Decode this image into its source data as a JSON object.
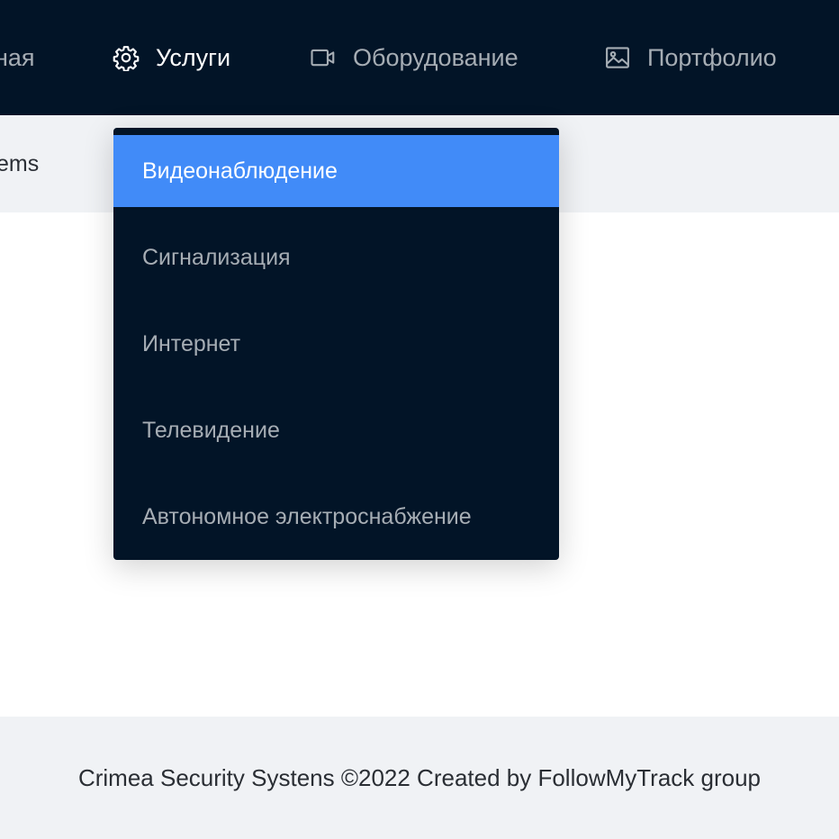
{
  "nav": {
    "items": [
      {
        "label": "ная",
        "icon": ""
      },
      {
        "label": "Услуги",
        "icon": "gear-icon",
        "active": true
      },
      {
        "label": "Оборудование",
        "icon": "video-camera-icon"
      },
      {
        "label": "Портфолио",
        "icon": "image-icon"
      }
    ]
  },
  "subbar": {
    "text": "ems"
  },
  "dropdown": {
    "items": [
      {
        "label": "Видеонаблюдение",
        "selected": true
      },
      {
        "label": "Сигнализация"
      },
      {
        "label": "Интернет"
      },
      {
        "label": "Телевидение"
      },
      {
        "label": "Автономное электроснабжение"
      }
    ]
  },
  "footer": {
    "text": "Crimea Security Systens ©2022 Created by FollowMyTrack group"
  },
  "colors": {
    "nav_bg": "#021427",
    "active_text": "#ffffff",
    "inactive_text": "#a6adb4",
    "selected_bg": "#418bf8",
    "page_bg": "#f0f2f5"
  }
}
